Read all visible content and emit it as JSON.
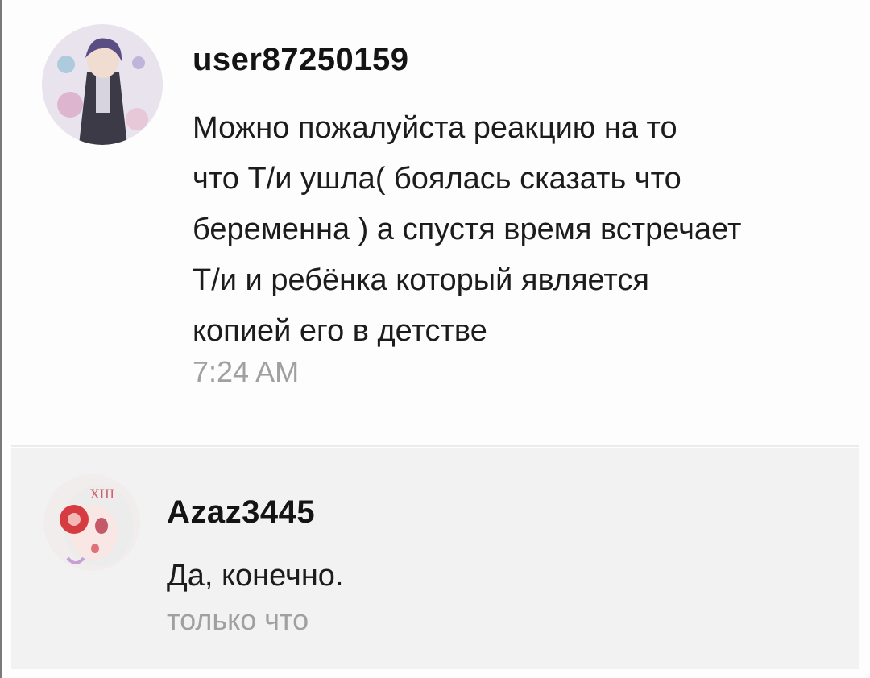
{
  "comments": [
    {
      "username": "user87250159",
      "message_lines": [
        "Можно пожалуйста реакцию на то",
        "что Т/и ушла( боялась сказать что",
        "беременна ) а спустя время встречает",
        "Т/и и ребёнка который является",
        "копией его в детстве"
      ],
      "timestamp": "7:24 AM",
      "avatar_icon": "anime-boy-avatar"
    },
    {
      "username": "Azaz3445",
      "message": "Да, конечно.",
      "timestamp": "только что",
      "avatar_icon": "anime-girl-avatar"
    }
  ],
  "colors": {
    "username": "#141414",
    "message": "#1c1c1c",
    "timestamp": "#a0a0a0",
    "reply_background": "#f2f2f2",
    "page_background": "#fdfdfd"
  }
}
